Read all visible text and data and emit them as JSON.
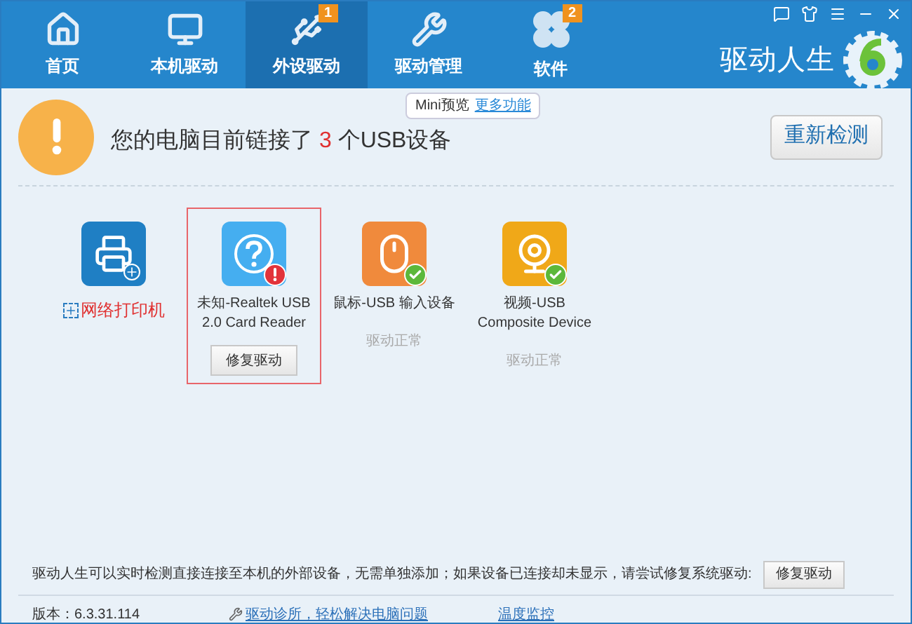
{
  "nav": [
    {
      "label": "首页",
      "selected": false
    },
    {
      "label": "本机驱动",
      "selected": false
    },
    {
      "label": "外设驱动",
      "selected": true,
      "badge": "1"
    },
    {
      "label": "驱动管理",
      "selected": false
    },
    {
      "label": "软件",
      "selected": false,
      "badge": "2"
    }
  ],
  "brand": "驱动人生",
  "alert": {
    "before": "您的电脑目前链接了",
    "count": "3",
    "after": "个USB设备",
    "button": "重新检测"
  },
  "tooltip": {
    "text": "Mini预览",
    "link": "更多功能"
  },
  "devices": [
    {
      "kind": "printer",
      "label": "网络打印机",
      "selected": false
    },
    {
      "kind": "unknown",
      "label": "未知-Realtek USB 2.0 Card Reader",
      "selected": true,
      "button": "修复驱动"
    },
    {
      "kind": "mouse",
      "label": "鼠标-USB 输入设备",
      "selected": false,
      "status": "驱动正常"
    },
    {
      "kind": "camera",
      "label": "视频-USB Composite Device",
      "selected": false,
      "status": "驱动正常"
    }
  ],
  "hint": {
    "text": "驱动人生可以实时检测直接连接至本机的外部设备，无需单独添加；如果设备已连接却未显示，请尝试修复系统驱动:",
    "button": "修复驱动"
  },
  "status_bar": {
    "version": "版本：6.3.31.114",
    "link": "驱动诊所，轻松解决电脑问题",
    "monitor": "温度监控"
  }
}
